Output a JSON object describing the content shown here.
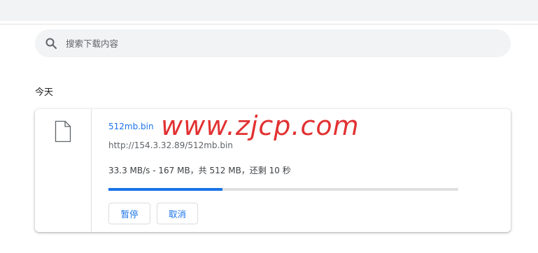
{
  "search": {
    "placeholder": "搜索下载内容",
    "icon": "search-icon"
  },
  "section": {
    "label": "今天"
  },
  "download": {
    "file_icon": "file-icon",
    "file_name": "512mb.bin",
    "url": "http://154.3.32.89/512mb.bin",
    "status": "33.3 MB/s - 167 MB，共 512 MB，还剩 10 秒",
    "progress_fraction": 0.326,
    "pause_label": "暂停",
    "cancel_label": "取消"
  },
  "watermark": {
    "text": "www.zjcp.com"
  },
  "colors": {
    "accent": "#1a73e8",
    "watermark": "#e02020",
    "search_bg": "#f1f3f4"
  }
}
